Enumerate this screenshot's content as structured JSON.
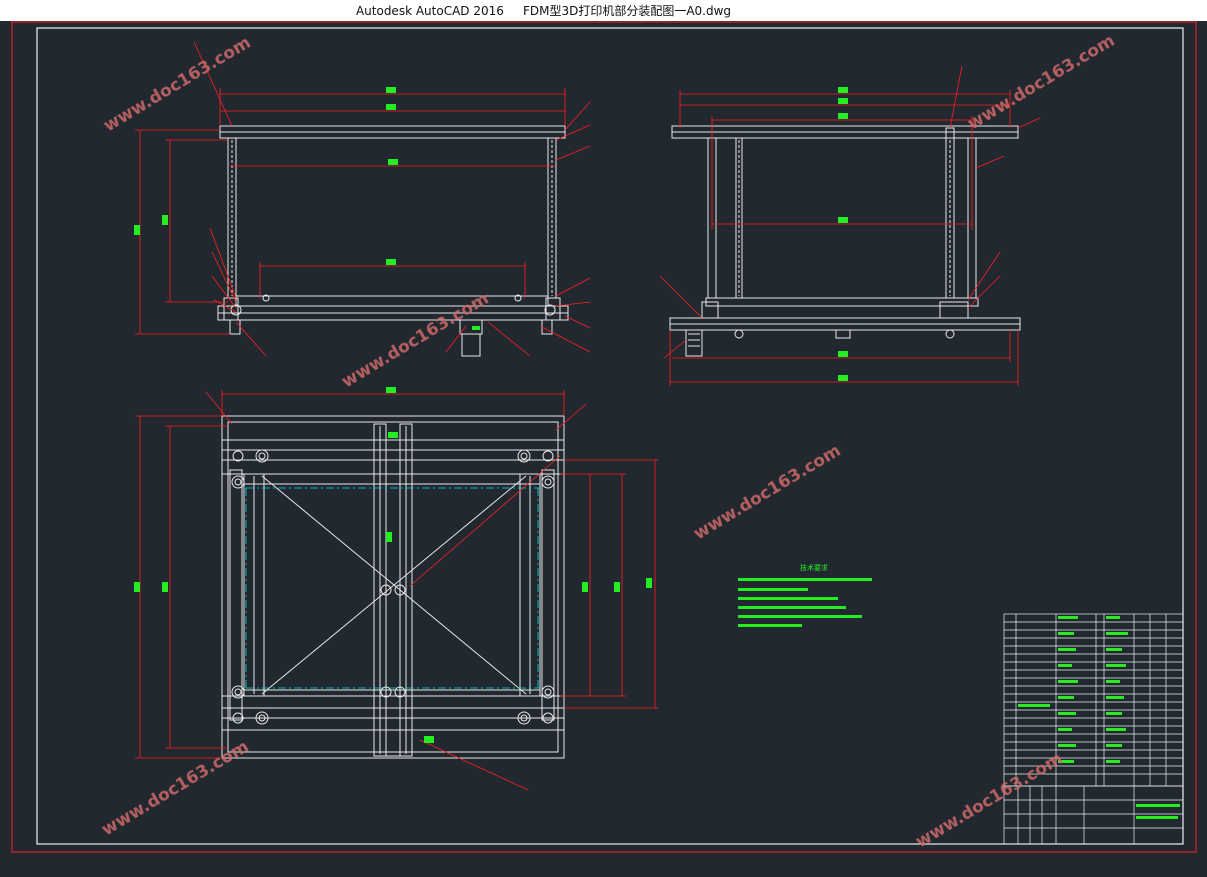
{
  "window": {
    "app_name": "Autodesk AutoCAD 2016",
    "file_name": "FDM型3D打印机部分装配图一A0.dwg"
  },
  "watermark": {
    "text": "www.doc163.com"
  },
  "colors": {
    "background": "#212830",
    "frame": "#ff2020",
    "border": "#ffffff",
    "geometry": "#e8e8e8",
    "dimension": "#ff1e1e",
    "centerline": "#00e0e0",
    "dim_text": "#22ee22",
    "notes": "#22ee22",
    "watermark": "#d06a6a"
  },
  "drawing": {
    "notes_title": "技术要求"
  }
}
